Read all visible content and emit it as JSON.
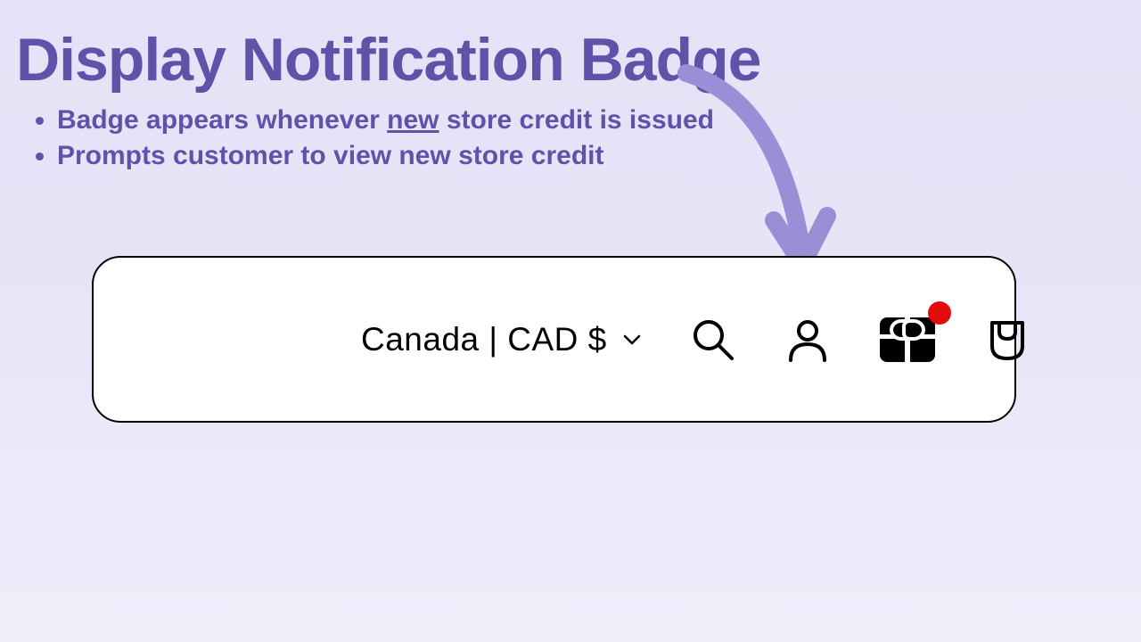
{
  "title": "Display Notification Badge",
  "bullets": {
    "item1_pre": "Badge appears whenever ",
    "item1_underlined": "new",
    "item1_post": " store credit is issued",
    "item2": "Prompts customer to view new store credit"
  },
  "toolbar": {
    "currency_label": "Canada | CAD $"
  },
  "colors": {
    "accent": "#5f52a8",
    "badge": "#e30c0c"
  }
}
